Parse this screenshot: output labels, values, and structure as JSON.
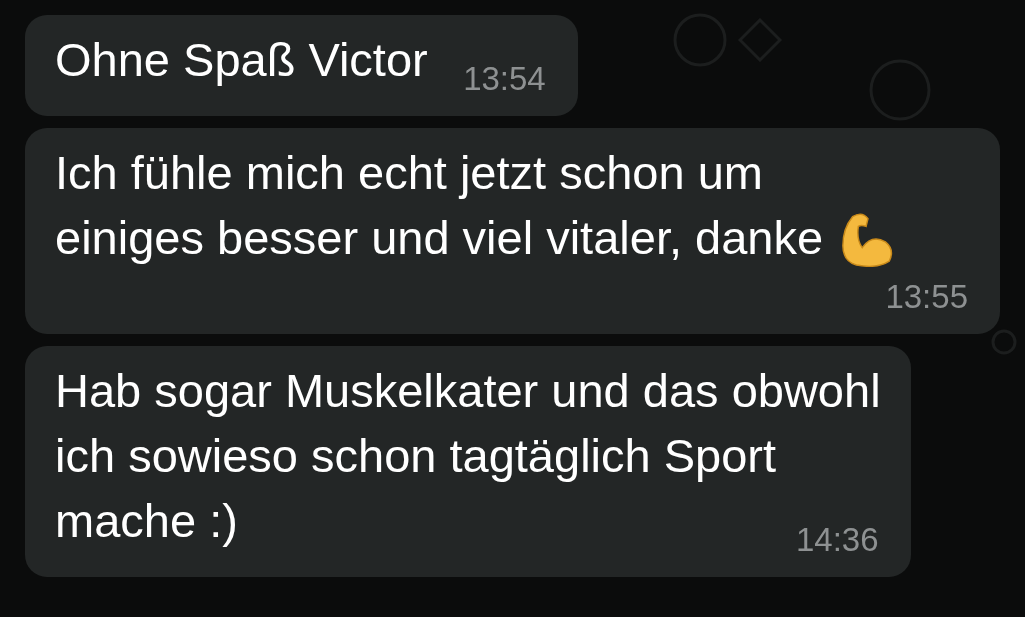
{
  "messages": [
    {
      "lines": [
        "Ohne Spaß Victor"
      ],
      "time": "13:54",
      "emoji": false
    },
    {
      "lines": [
        "Ich fühle mich echt jetzt schon um",
        "einiges besser und viel vitaler, danke"
      ],
      "time": "13:55",
      "emoji": true
    },
    {
      "lines": [
        "Hab sogar Muskelkater und das obwohl",
        "ich sowieso schon tagtäglich Sport",
        "mache :)"
      ],
      "time": "14:36",
      "emoji": false
    }
  ]
}
